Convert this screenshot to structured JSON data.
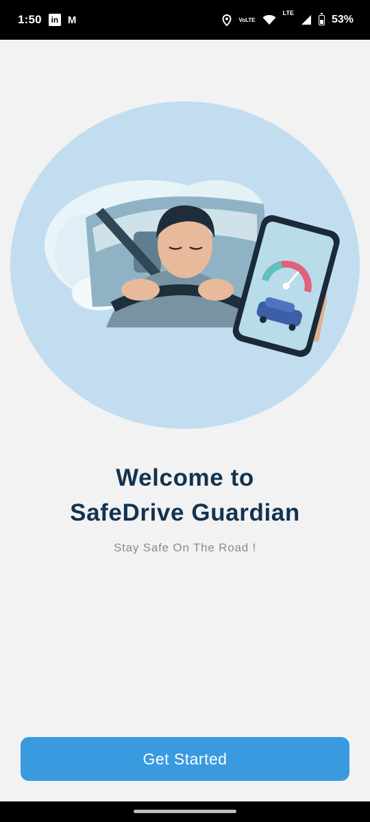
{
  "status_bar": {
    "time": "1:50",
    "app_icons": [
      "linkedin-icon",
      "gmail-icon"
    ],
    "volte_top": "Vo",
    "volte_bottom": "LTE",
    "lte": "LTE",
    "battery_percent": "53%",
    "battery_level": 0.53
  },
  "hero": {
    "illustration": "drowsy-driver-with-phone-speedometer"
  },
  "welcome": {
    "line1": "Welcome to",
    "line2": "SafeDrive Guardian",
    "tagline": "Stay Safe On The Road !"
  },
  "actions": {
    "get_started_label": "Get Started"
  },
  "colors": {
    "accent": "#3a9ae0",
    "title": "#12334f",
    "hero_bg": "#c3ddf0",
    "background": "#f2f2f3"
  }
}
